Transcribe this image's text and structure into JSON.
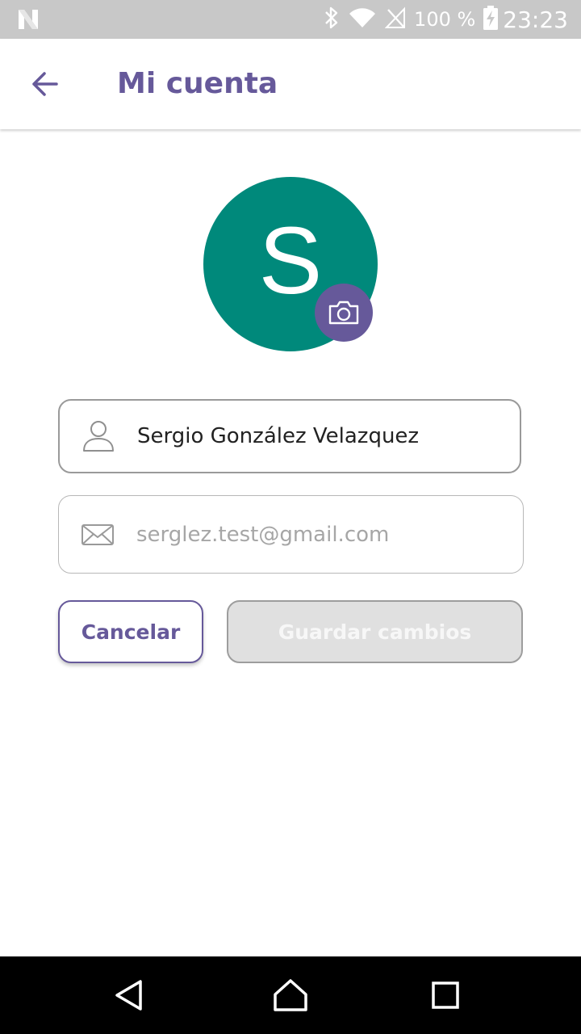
{
  "status_bar": {
    "battery_percent": "100 %",
    "time": "23:23",
    "icons": [
      "notification-n-icon",
      "bluetooth-icon",
      "wifi-icon",
      "no-signal-icon",
      "battery-charging-icon"
    ]
  },
  "app_bar": {
    "title": "Mi cuenta",
    "back_icon": "arrow-left-icon"
  },
  "profile": {
    "avatar_initial": "S",
    "avatar_color": "#00897b",
    "camera_icon": "camera-icon"
  },
  "form": {
    "name_value": "Sergio González Velazquez",
    "email_value": "serglez.test@gmail.com"
  },
  "actions": {
    "cancel_label": "Cancelar",
    "save_label": "Guardar cambios"
  },
  "colors": {
    "accent": "#66599a",
    "avatar": "#00897b",
    "disabled": "#e0e0e0"
  },
  "nav_bar": {
    "icons": [
      "nav-back-icon",
      "nav-home-icon",
      "nav-recents-icon"
    ]
  }
}
